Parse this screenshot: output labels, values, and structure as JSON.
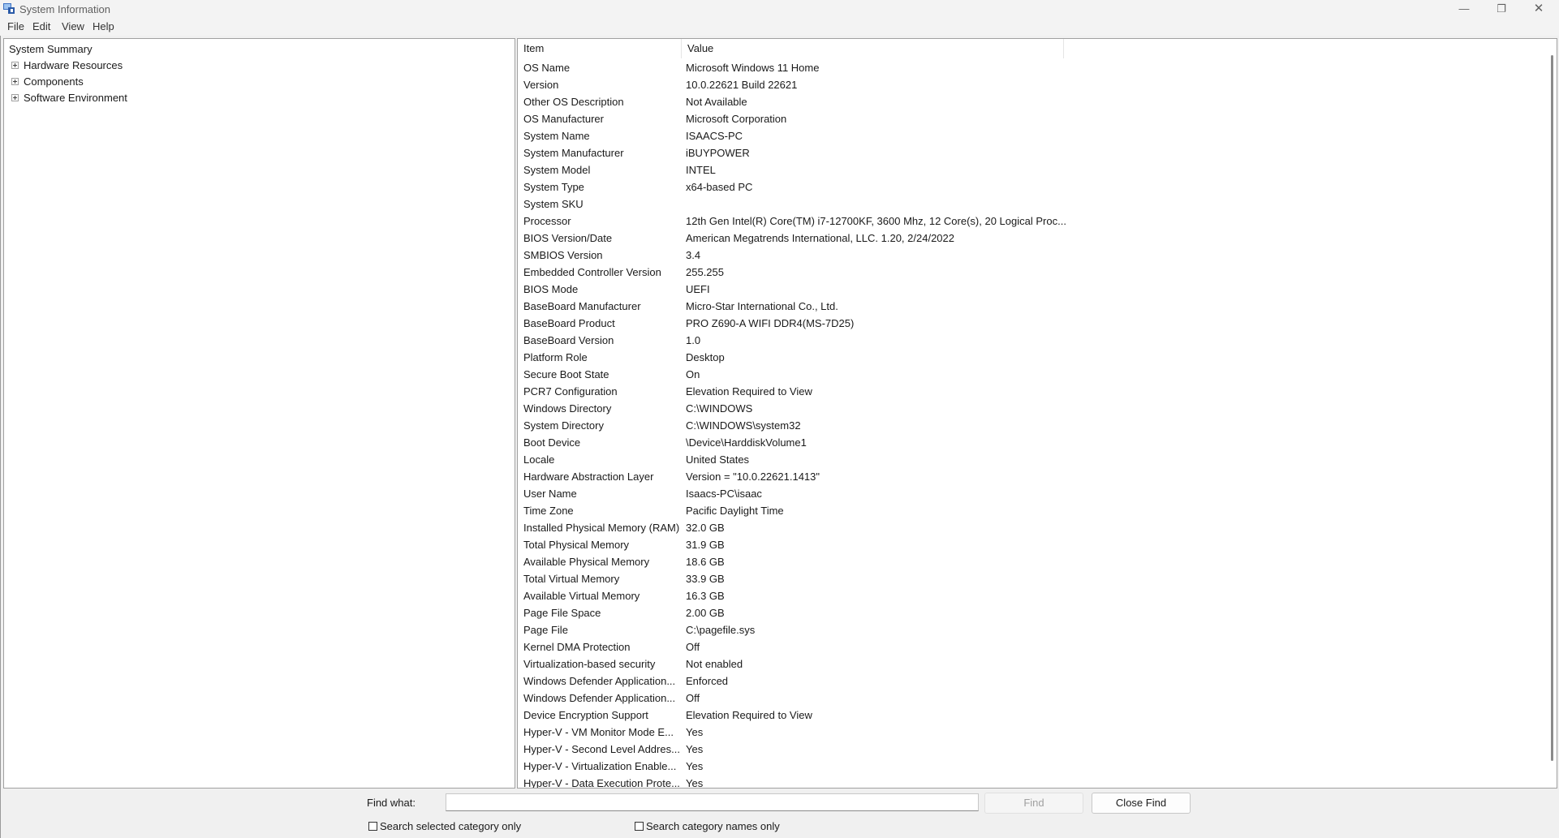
{
  "window": {
    "title": "System Information",
    "controls": {
      "minimize": "—",
      "maximize": "❐",
      "close": "✕"
    }
  },
  "menu": [
    "File",
    "Edit",
    "View",
    "Help"
  ],
  "tree": {
    "root": "System Summary",
    "children": [
      "Hardware Resources",
      "Components",
      "Software Environment"
    ]
  },
  "details": {
    "columns": {
      "item": "Item",
      "value": "Value"
    },
    "rows": [
      {
        "item": "OS Name",
        "value": "Microsoft Windows 11 Home"
      },
      {
        "item": "Version",
        "value": "10.0.22621 Build 22621"
      },
      {
        "item": "Other OS Description",
        "value": "Not Available"
      },
      {
        "item": "OS Manufacturer",
        "value": "Microsoft Corporation"
      },
      {
        "item": "System Name",
        "value": "ISAACS-PC"
      },
      {
        "item": "System Manufacturer",
        "value": "iBUYPOWER"
      },
      {
        "item": "System Model",
        "value": "INTEL"
      },
      {
        "item": "System Type",
        "value": "x64-based PC"
      },
      {
        "item": "System SKU",
        "value": ""
      },
      {
        "item": "Processor",
        "value": "12th Gen Intel(R) Core(TM) i7-12700KF, 3600 Mhz, 12 Core(s), 20 Logical Proc..."
      },
      {
        "item": "BIOS Version/Date",
        "value": "American Megatrends International, LLC. 1.20, 2/24/2022"
      },
      {
        "item": "SMBIOS Version",
        "value": "3.4"
      },
      {
        "item": "Embedded Controller Version",
        "value": "255.255"
      },
      {
        "item": "BIOS Mode",
        "value": "UEFI"
      },
      {
        "item": "BaseBoard Manufacturer",
        "value": "Micro-Star International Co., Ltd."
      },
      {
        "item": "BaseBoard Product",
        "value": "PRO Z690-A WIFI DDR4(MS-7D25)"
      },
      {
        "item": "BaseBoard Version",
        "value": "1.0"
      },
      {
        "item": "Platform Role",
        "value": "Desktop"
      },
      {
        "item": "Secure Boot State",
        "value": "On"
      },
      {
        "item": "PCR7 Configuration",
        "value": "Elevation Required to View"
      },
      {
        "item": "Windows Directory",
        "value": "C:\\WINDOWS"
      },
      {
        "item": "System Directory",
        "value": "C:\\WINDOWS\\system32"
      },
      {
        "item": "Boot Device",
        "value": "\\Device\\HarddiskVolume1"
      },
      {
        "item": "Locale",
        "value": "United States"
      },
      {
        "item": "Hardware Abstraction Layer",
        "value": "Version = \"10.0.22621.1413\""
      },
      {
        "item": "User Name",
        "value": "Isaacs-PC\\isaac"
      },
      {
        "item": "Time Zone",
        "value": "Pacific Daylight Time"
      },
      {
        "item": "Installed Physical Memory (RAM)",
        "value": "32.0 GB"
      },
      {
        "item": "Total Physical Memory",
        "value": "31.9 GB"
      },
      {
        "item": "Available Physical Memory",
        "value": "18.6 GB"
      },
      {
        "item": "Total Virtual Memory",
        "value": "33.9 GB"
      },
      {
        "item": "Available Virtual Memory",
        "value": "16.3 GB"
      },
      {
        "item": "Page File Space",
        "value": "2.00 GB"
      },
      {
        "item": "Page File",
        "value": "C:\\pagefile.sys"
      },
      {
        "item": "Kernel DMA Protection",
        "value": "Off"
      },
      {
        "item": "Virtualization-based security",
        "value": "Not enabled"
      },
      {
        "item": "Windows Defender Application...",
        "value": "Enforced"
      },
      {
        "item": "Windows Defender Application...",
        "value": "Off"
      },
      {
        "item": "Device Encryption Support",
        "value": "Elevation Required to View"
      },
      {
        "item": "Hyper-V - VM Monitor Mode E...",
        "value": "Yes"
      },
      {
        "item": "Hyper-V - Second Level Addres...",
        "value": "Yes"
      },
      {
        "item": "Hyper-V - Virtualization Enable...",
        "value": "Yes"
      },
      {
        "item": "Hyper-V - Data Execution Prote...",
        "value": "Yes"
      }
    ]
  },
  "find": {
    "label": "Find what:",
    "value": "",
    "find_button": "Find",
    "close_button": "Close Find",
    "option_selected_category": "Search selected category only",
    "option_category_names": "Search category names only"
  }
}
